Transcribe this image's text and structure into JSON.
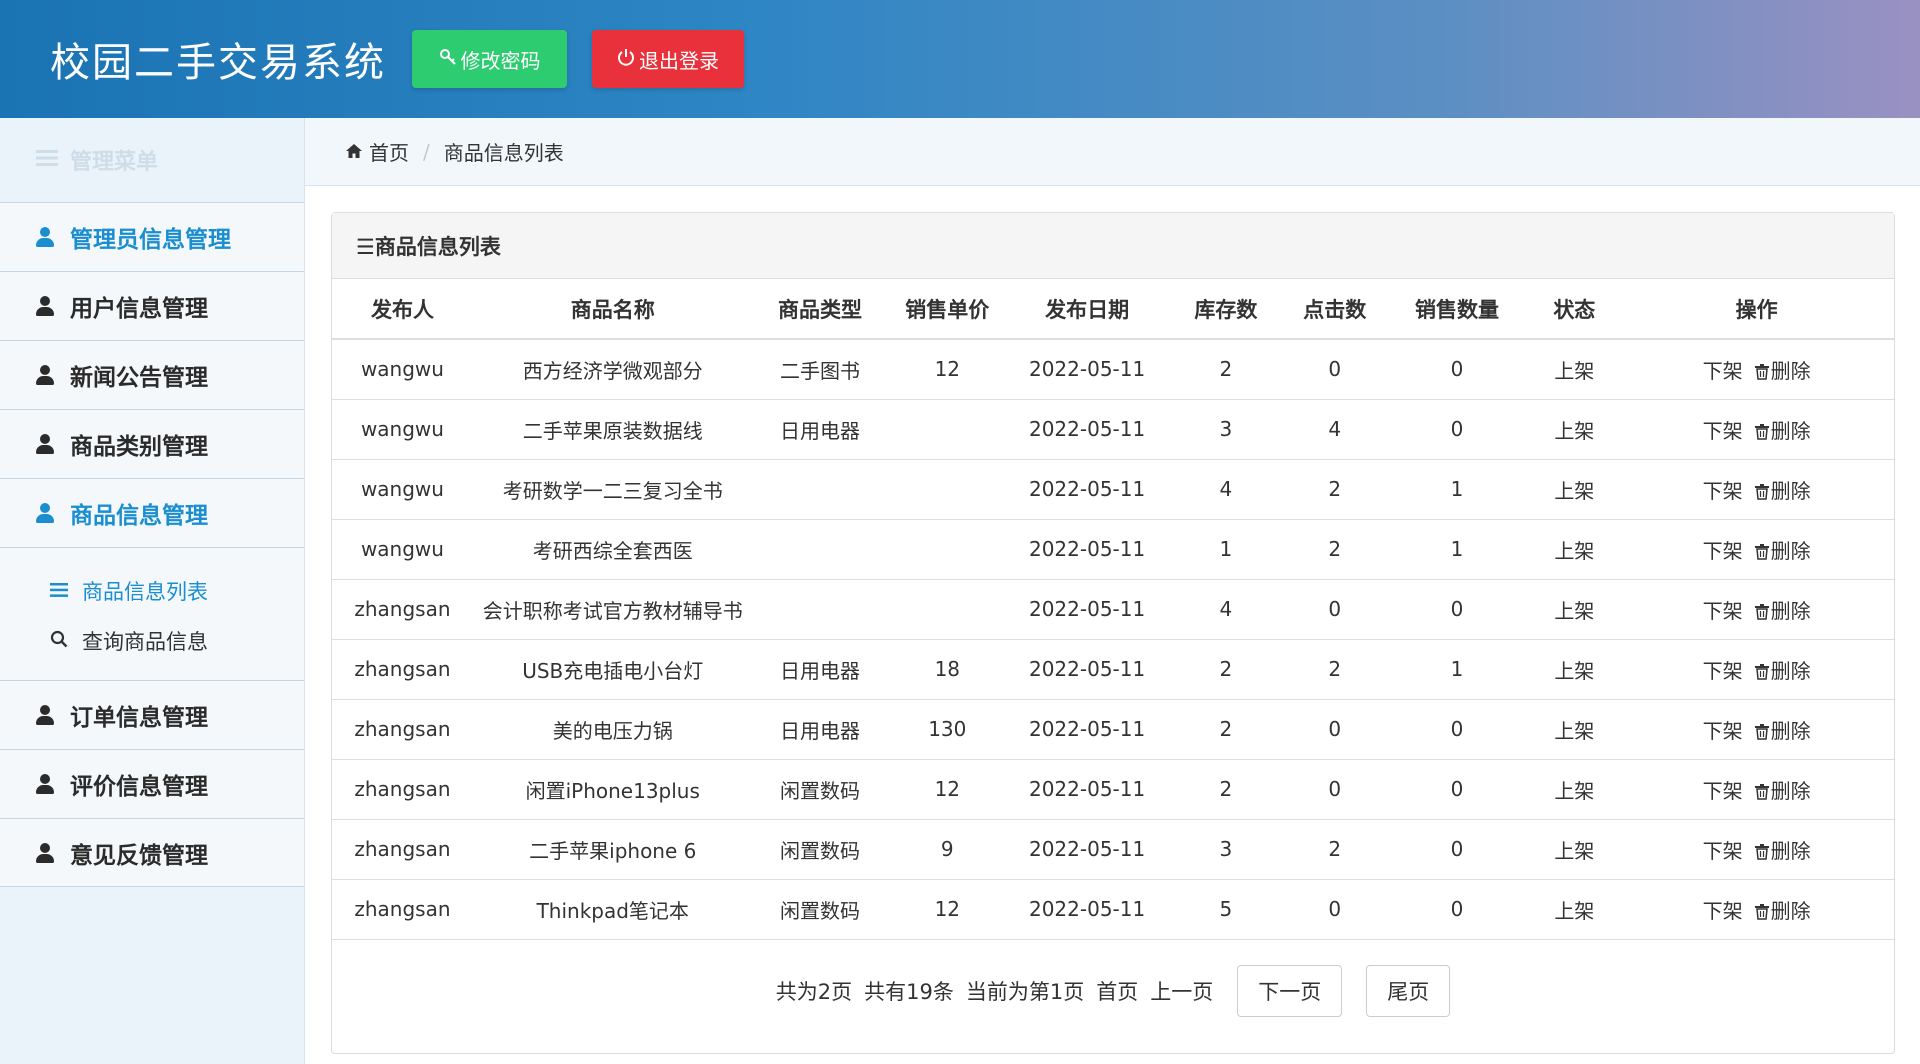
{
  "header": {
    "title": "校园二手交易系统",
    "change_password": "修改密码",
    "logout": "退出登录",
    "colors": {
      "change_password_bg": "#2ecc71",
      "logout_bg": "#e8313a"
    }
  },
  "sidebar": {
    "heading": "管理菜单",
    "items": [
      {
        "label": "管理员信息管理",
        "active": true
      },
      {
        "label": "用户信息管理"
      },
      {
        "label": "新闻公告管理"
      },
      {
        "label": "商品类别管理"
      },
      {
        "label": "商品信息管理",
        "active": true
      }
    ],
    "sub_items": [
      {
        "label": "商品信息列表",
        "icon": "list-icon",
        "active": true
      },
      {
        "label": "查询商品信息",
        "icon": "search-icon"
      }
    ],
    "items_after": [
      {
        "label": "订单信息管理"
      },
      {
        "label": "评价信息管理"
      },
      {
        "label": "意见反馈管理"
      }
    ]
  },
  "breadcrumb": {
    "home": "首页",
    "current": "商品信息列表"
  },
  "panel": {
    "title": "☰商品信息列表"
  },
  "table": {
    "headers": [
      "发布人",
      "商品名称",
      "商品类型",
      "销售单价",
      "发布日期",
      "库存数",
      "点击数",
      "销售数量",
      "状态",
      "操作"
    ],
    "rows": [
      [
        "wangwu",
        "西方经济学微观部分",
        "二手图书",
        "12",
        "2022-05-11",
        "2",
        "0",
        "0",
        "上架"
      ],
      [
        "wangwu",
        "二手苹果原装数据线",
        "日用电器",
        "",
        "2022-05-11",
        "3",
        "4",
        "0",
        "上架"
      ],
      [
        "wangwu",
        "考研数学一二三复习全书",
        "",
        "",
        "2022-05-11",
        "4",
        "2",
        "1",
        "上架"
      ],
      [
        "wangwu",
        "考研西综全套西医",
        "",
        "",
        "2022-05-11",
        "1",
        "2",
        "1",
        "上架"
      ],
      [
        "zhangsan",
        "会计职称考试官方教材辅导书",
        "",
        "",
        "2022-05-11",
        "4",
        "0",
        "0",
        "上架"
      ],
      [
        "zhangsan",
        "USB充电插电小台灯",
        "日用电器",
        "18",
        "2022-05-11",
        "2",
        "2",
        "1",
        "上架"
      ],
      [
        "zhangsan",
        "美的电压力锅",
        "日用电器",
        "130",
        "2022-05-11",
        "2",
        "0",
        "0",
        "上架"
      ],
      [
        "zhangsan",
        "闲置iPhone13plus",
        "闲置数码",
        "12",
        "2022-05-11",
        "2",
        "0",
        "0",
        "上架"
      ],
      [
        "zhangsan",
        "二手苹果iphone 6",
        "闲置数码",
        "9",
        "2022-05-11",
        "3",
        "2",
        "0",
        "上架"
      ],
      [
        "zhangsan",
        "Thinkpad笔记本",
        "闲置数码",
        "12",
        "2022-05-11",
        "5",
        "0",
        "0",
        "上架"
      ]
    ],
    "op_off": "下架",
    "op_delete": "删除"
  },
  "pager": {
    "total_pages": "共为2页",
    "total_records": "共有19条",
    "current": "当前为第1页",
    "first": "首页",
    "prev": "上一页",
    "next": "下一页",
    "last": "尾页"
  }
}
